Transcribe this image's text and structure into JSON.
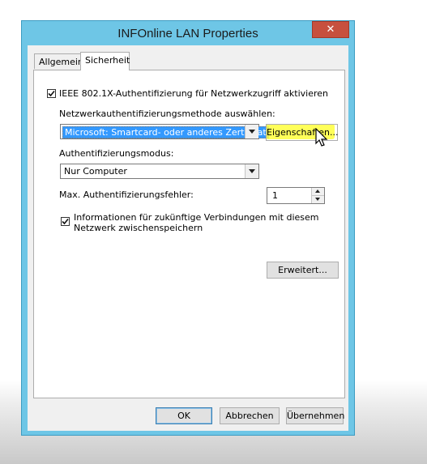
{
  "window": {
    "title": "INFOnline LAN Properties",
    "close_glyph": "✕"
  },
  "tabs": [
    {
      "label": "Allgemein",
      "active": false
    },
    {
      "label": "Sicherheit",
      "active": true
    }
  ],
  "security": {
    "enable_8021x": {
      "label": "IEEE 802.1X-Authentifizierung für Netzwerkzugriff aktivieren",
      "checked": true
    },
    "method_label": "Netzwerkauthentifizierungsmethode auswählen:",
    "method_value": "Microsoft: Smartcard- oder anderes Zertifikat",
    "properties_button": "Eigenschaften...",
    "auth_mode_label": "Authentifizierungsmodus:",
    "auth_mode_value": "Nur Computer",
    "max_failures_label": "Max. Authentifizierungsfehler:",
    "max_failures_value": "1",
    "cache_info": {
      "label_line1": "Informationen für zukünftige Verbindungen mit diesem",
      "label_line2": "Netzwerk zwischenspeichern",
      "checked": true
    },
    "advanced_button": "Erweitert..."
  },
  "footer": {
    "ok": "OK",
    "cancel": "Abbrechen",
    "apply": "Übernehmen"
  },
  "colors": {
    "window_frame": "#6ec6e6",
    "close_button": "#c7503e",
    "selection": "#3399ff",
    "annotation_highlight": "#ffff3c"
  },
  "icons": [
    "close-icon",
    "checkmark-icon",
    "dropdown-arrow-icon",
    "spin-up-icon",
    "spin-down-icon",
    "mouse-cursor-icon"
  ]
}
